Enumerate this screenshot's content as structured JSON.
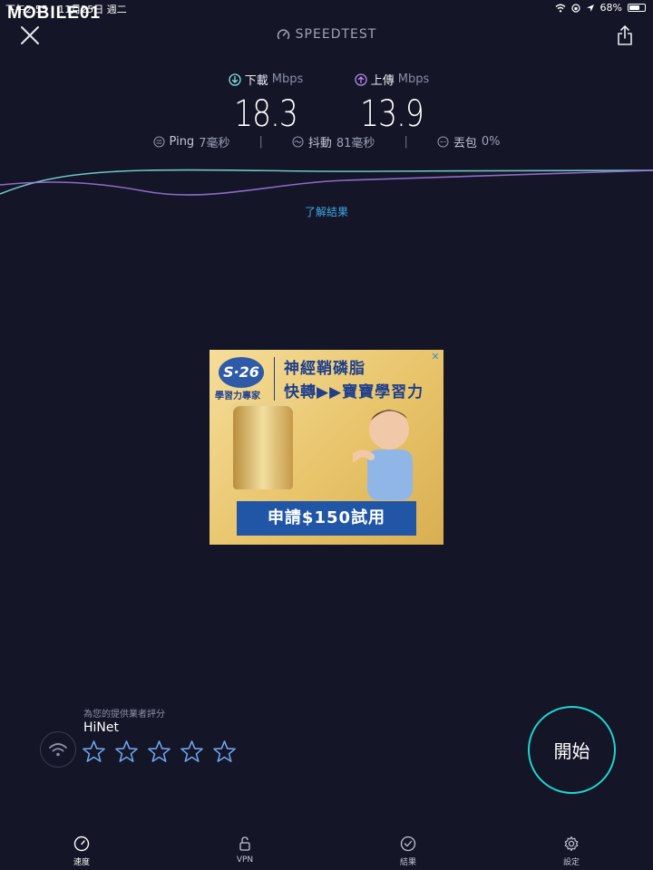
{
  "status_bar": {
    "time": "下午2:55",
    "date": "11月25日 週二",
    "watermark": "MOBILE01",
    "battery": "68%",
    "battery_level": 0.68
  },
  "header": {
    "brand": "SPEEDTEST"
  },
  "results": {
    "download_label": "下載",
    "download_unit": "Mbps",
    "download_value": "18.3",
    "upload_label": "上傳",
    "upload_unit": "Mbps",
    "upload_value": "13.9",
    "ping_label": "Ping",
    "ping_value": "7毫秒",
    "jitter_label": "抖動",
    "jitter_value": "81毫秒",
    "loss_label": "丟包",
    "loss_value": "0%"
  },
  "learn_more": "了解結果",
  "ad": {
    "logo": "S·26",
    "subtitle": "學習力專家",
    "headline_line1": "神經鞘磷脂",
    "headline_line2": "快轉▶▶寶寶學習力",
    "cta": "申請$150試用",
    "close": "✕"
  },
  "rating": {
    "caption": "為您的提供業者評分",
    "provider": "HiNet",
    "stars_filled": 0,
    "stars_total": 5
  },
  "go_button": "開始",
  "colors": {
    "background": "#141526",
    "accent_cyan": "#1fd4d0",
    "download_icon": "#7fe3e0",
    "upload_icon": "#b58cf0",
    "link": "#3fa8e6",
    "star": "#6fa8f0"
  },
  "tabs": [
    {
      "label": "速度",
      "icon": "speed-gauge-icon"
    },
    {
      "label": "VPN",
      "icon": "lock-icon"
    },
    {
      "label": "結果",
      "icon": "check-circle-icon"
    },
    {
      "label": "設定",
      "icon": "gear-icon"
    }
  ]
}
